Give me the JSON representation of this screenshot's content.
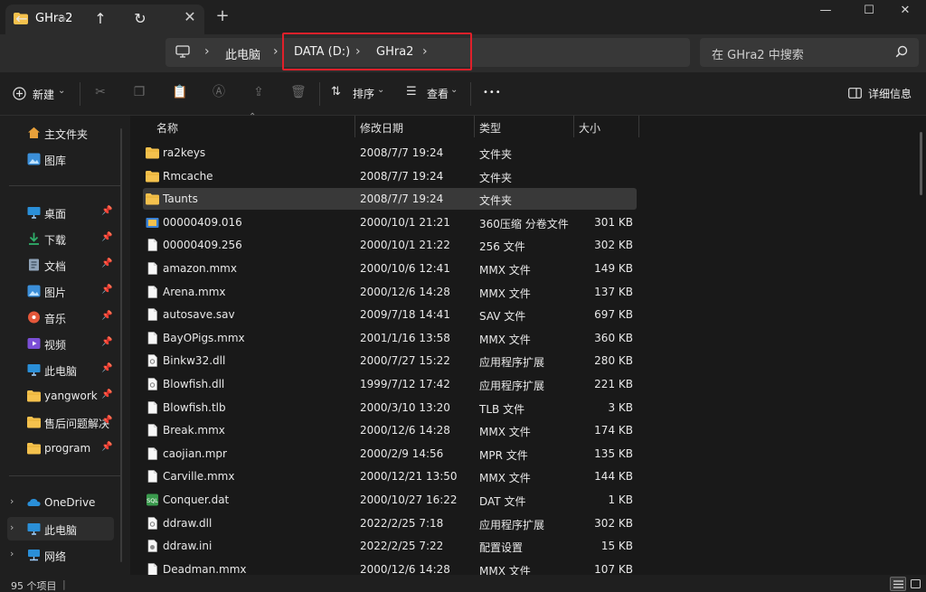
{
  "window": {
    "tab_title": "GHra2",
    "tab_close": "✕",
    "new_tab": "+",
    "minimize": "—",
    "maximize": "☐",
    "close": "✕"
  },
  "nav": {
    "back": "←",
    "forward": "→",
    "up": "↑",
    "refresh": "↻"
  },
  "breadcrumb": {
    "separator": "›",
    "items": [
      "此电脑",
      "DATA (D:)",
      "GHra2"
    ]
  },
  "search": {
    "placeholder": "在 GHra2 中搜索"
  },
  "toolbar": {
    "new_label": "新建",
    "sort_label": "排序",
    "view_label": "查看",
    "more_label": "•••",
    "details_label": "详细信息"
  },
  "sidebar": {
    "pinned_top": [
      {
        "label": "主文件夹",
        "icon": "home-icon",
        "color": "#e8a03a"
      },
      {
        "label": "图库",
        "icon": "gallery-icon",
        "color": "#3b8fd9"
      }
    ],
    "quick_access": [
      {
        "label": "桌面",
        "icon": "desktop-icon",
        "color": "#2a8fd8"
      },
      {
        "label": "下载",
        "icon": "download-icon",
        "color": "#2fae6a"
      },
      {
        "label": "文档",
        "icon": "documents-icon",
        "color": "#8fa3b8"
      },
      {
        "label": "图片",
        "icon": "pictures-icon",
        "color": "#3b8fd9"
      },
      {
        "label": "音乐",
        "icon": "music-icon",
        "color": "#e4573a"
      },
      {
        "label": "视频",
        "icon": "videos-icon",
        "color": "#7b4fd6"
      },
      {
        "label": "此电脑",
        "icon": "this-pc-icon",
        "color": "#2a8fd8"
      },
      {
        "label": "yangwork",
        "icon": "folder-icon",
        "color": "#f4c14d"
      },
      {
        "label": "售后问题解决",
        "icon": "folder-icon",
        "color": "#f4c14d"
      },
      {
        "label": "program",
        "icon": "folder-icon",
        "color": "#f4c14d"
      }
    ],
    "pin_glyph": "📌",
    "drives": [
      {
        "label": "OneDrive",
        "icon": "onedrive-icon",
        "color": "#2a8fd8"
      },
      {
        "label": "此电脑",
        "icon": "this-pc-icon",
        "color": "#2a8fd8"
      },
      {
        "label": "网络",
        "icon": "network-icon",
        "color": "#2a8fd8"
      }
    ]
  },
  "columns": {
    "name": "名称",
    "date": "修改日期",
    "type": "类型",
    "size": "大小"
  },
  "files": [
    {
      "name": "ra2keys",
      "date": "2008/7/7 19:24",
      "type": "文件夹",
      "size": "",
      "icon": "folder-icon"
    },
    {
      "name": "Rmcache",
      "date": "2008/7/7 19:24",
      "type": "文件夹",
      "size": "",
      "icon": "folder-icon"
    },
    {
      "name": "Taunts",
      "date": "2008/7/7 19:24",
      "type": "文件夹",
      "size": "",
      "icon": "folder-icon"
    },
    {
      "name": "00000409.016",
      "date": "2000/10/1 21:21",
      "type": "360压缩 分卷文件",
      "size": "301 KB",
      "icon": "archive-icon"
    },
    {
      "name": "00000409.256",
      "date": "2000/10/1 21:22",
      "type": "256 文件",
      "size": "302 KB",
      "icon": "file-icon"
    },
    {
      "name": "amazon.mmx",
      "date": "2000/10/6 12:41",
      "type": "MMX 文件",
      "size": "149 KB",
      "icon": "file-icon"
    },
    {
      "name": "Arena.mmx",
      "date": "2000/12/6 14:28",
      "type": "MMX 文件",
      "size": "137 KB",
      "icon": "file-icon"
    },
    {
      "name": "autosave.sav",
      "date": "2009/7/18 14:41",
      "type": "SAV 文件",
      "size": "697 KB",
      "icon": "file-icon"
    },
    {
      "name": "BayOPigs.mmx",
      "date": "2001/1/16 13:58",
      "type": "MMX 文件",
      "size": "360 KB",
      "icon": "file-icon"
    },
    {
      "name": "Binkw32.dll",
      "date": "2000/7/27 15:22",
      "type": "应用程序扩展",
      "size": "280 KB",
      "icon": "dll-icon"
    },
    {
      "name": "Blowfish.dll",
      "date": "1999/7/12 17:42",
      "type": "应用程序扩展",
      "size": "221 KB",
      "icon": "dll-icon"
    },
    {
      "name": "Blowfish.tlb",
      "date": "2000/3/10 13:20",
      "type": "TLB 文件",
      "size": "3 KB",
      "icon": "file-icon"
    },
    {
      "name": "Break.mmx",
      "date": "2000/12/6 14:28",
      "type": "MMX 文件",
      "size": "174 KB",
      "icon": "file-icon"
    },
    {
      "name": "caojian.mpr",
      "date": "2000/2/9 14:56",
      "type": "MPR 文件",
      "size": "135 KB",
      "icon": "file-icon"
    },
    {
      "name": "Carville.mmx",
      "date": "2000/12/21 13:50",
      "type": "MMX 文件",
      "size": "144 KB",
      "icon": "file-icon"
    },
    {
      "name": "Conquer.dat",
      "date": "2000/10/27 16:22",
      "type": "DAT 文件",
      "size": "1 KB",
      "icon": "dat-icon"
    },
    {
      "name": "ddraw.dll",
      "date": "2022/2/25 7:18",
      "type": "应用程序扩展",
      "size": "302 KB",
      "icon": "dll-icon"
    },
    {
      "name": "ddraw.ini",
      "date": "2022/2/25 7:22",
      "type": "配置设置",
      "size": "15 KB",
      "icon": "ini-icon"
    },
    {
      "name": "Deadman.mmx",
      "date": "2000/12/6 14:28",
      "type": "MMX 文件",
      "size": "107 KB",
      "icon": "file-icon"
    }
  ],
  "selected_file": "Taunts",
  "status": {
    "item_count": "95 个项目",
    "divider": "|"
  },
  "colors": {
    "accent_highlight": "#e0202a",
    "folder": "#f4c14d",
    "selected_row": "#393939"
  }
}
